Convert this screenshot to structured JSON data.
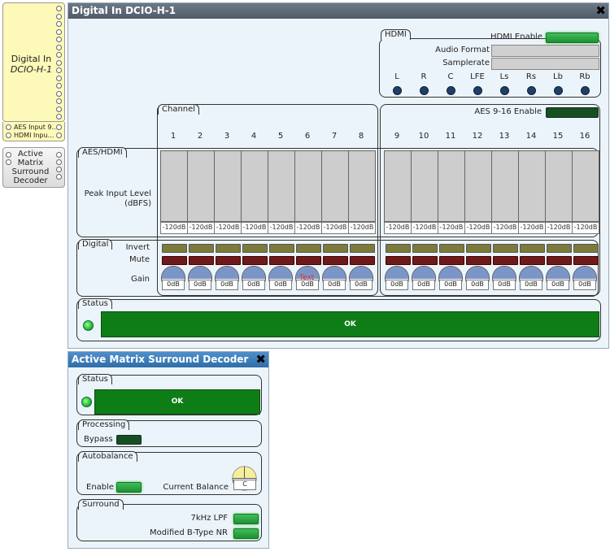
{
  "palette": {
    "digital_block": {
      "title_line1": "Digital In",
      "title_line2": "DCIO-H-1",
      "io1": "AES Input 9…",
      "io2": "HDMI Inpu…"
    },
    "amsd_block": {
      "line1": "Active",
      "line2": "Matrix",
      "line3": "Surround",
      "line4": "Decoder"
    }
  },
  "digital_window": {
    "title": "Digital In DCIO-H-1",
    "close_icon": "close-icon",
    "hdmi": {
      "tab": "HDMI",
      "enable_label": "HDMI Enable",
      "audio_format_label": "Audio Format",
      "samplerate_label": "Samplerate",
      "channels": [
        "L",
        "R",
        "C",
        "LFE",
        "Ls",
        "Rs",
        "Lb",
        "Rb"
      ]
    },
    "channel_tab": "Channel",
    "aes_enable_label": "AES 9-16 Enable",
    "channel_numbers": [
      "1",
      "2",
      "3",
      "4",
      "5",
      "6",
      "7",
      "8",
      "9",
      "10",
      "11",
      "12",
      "13",
      "14",
      "15",
      "16"
    ],
    "aes_hdmi_tab": "AES/HDMI",
    "peak_label_line1": "Peak Input Level",
    "peak_label_line2": "(dBFS)",
    "meter_values": [
      "-120dB",
      "-120dB",
      "-120dB",
      "-120dB",
      "-120dB",
      "-120dB",
      "-120dB",
      "-120dB",
      "-120dB",
      "-120dB",
      "-120dB",
      "-120dB",
      "-120dB",
      "-120dB",
      "-120dB",
      "-120dB"
    ],
    "digital_tab": "Digital",
    "invert_label": "Invert",
    "mute_label": "Mute",
    "gain_label": "Gain",
    "gain_values": [
      "0dB",
      "0dB",
      "0dB",
      "0dB",
      "0dB",
      "0dB",
      "0dB",
      "0dB",
      "0dB",
      "0dB",
      "0dB",
      "0dB",
      "0dB",
      "0dB",
      "0dB",
      "0dB"
    ],
    "gain_overlay_text": "Text",
    "status_tab": "Status",
    "status_text": "OK"
  },
  "amsd_window": {
    "title": "Active Matrix Surround Decoder",
    "status_tab": "Status",
    "status_text": "OK",
    "processing_tab": "Processing",
    "bypass_label": "Bypass",
    "autobalance_tab": "Autobalance",
    "enable_label": "Enable",
    "current_balance_label": "Current Balance",
    "balance_value": "C",
    "surround_tab": "Surround",
    "lpf_label": "7kHz LPF",
    "nr_label": "Modified B-Type NR"
  },
  "colors": {
    "title_bar": "#5a6775",
    "title_bar_amsd": "#3d7bb5",
    "ok_green": "#0f7d16",
    "window_bg": "#ecf4fb"
  }
}
